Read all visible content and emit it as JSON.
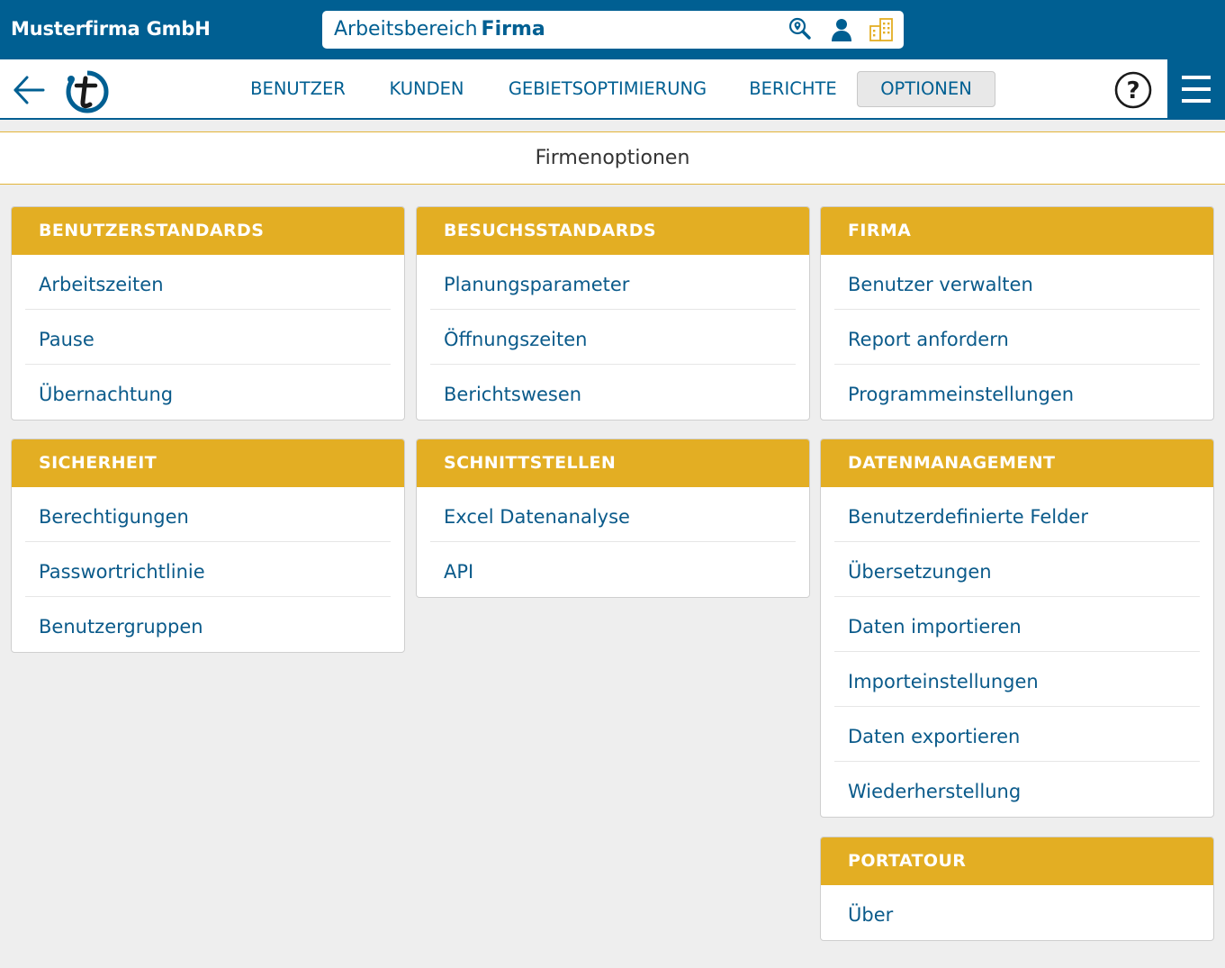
{
  "header": {
    "company_name": "Musterfirma GmbH",
    "workspace_prefix": "Arbeitsbereich",
    "workspace_name": "Firma",
    "icons": [
      "search-map-icon",
      "user-icon",
      "building-icon"
    ]
  },
  "nav": {
    "tabs": [
      {
        "label": "BENUTZER",
        "active": false
      },
      {
        "label": "KUNDEN",
        "active": false
      },
      {
        "label": "GEBIETSOPTIMIERUNG",
        "active": false
      },
      {
        "label": "BERICHTE",
        "active": false
      },
      {
        "label": "OPTIONEN",
        "active": true
      }
    ],
    "help_symbol": "?",
    "icons": [
      "back-arrow-icon",
      "portatour-logo",
      "help-icon",
      "hamburger-menu-icon"
    ]
  },
  "page": {
    "title": "Firmenoptionen"
  },
  "cards": [
    {
      "title": "BENUTZERSTANDARDS",
      "items": [
        "Arbeitszeiten",
        "Pause",
        "Übernachtung"
      ]
    },
    {
      "title": "BESUCHSSTANDARDS",
      "items": [
        "Planungsparameter",
        "Öffnungszeiten",
        "Berichtswesen"
      ]
    },
    {
      "title": "FIRMA",
      "items": [
        "Benutzer verwalten",
        "Report anfordern",
        "Programmeinstellungen"
      ]
    },
    {
      "title": "SICHERHEIT",
      "items": [
        "Berechtigungen",
        "Passwortrichtlinie",
        "Benutzergruppen"
      ]
    },
    {
      "title": "SCHNITTSTELLEN",
      "items": [
        "Excel Datenanalyse",
        "API"
      ]
    },
    {
      "title": "DATENMANAGEMENT",
      "items": [
        "Benutzerdefinierte Felder",
        "Übersetzungen",
        "Daten importieren",
        "Importeinstellungen",
        "Daten exportieren",
        "Wiederherstellung"
      ]
    },
    {
      "title": "PORTATOUR",
      "items": [
        "Über"
      ]
    }
  ],
  "colors": {
    "primary_blue": "#005f92",
    "accent_gold": "#e3ae23",
    "background": "#eeeeee",
    "link_text": "#0a5a8a"
  }
}
